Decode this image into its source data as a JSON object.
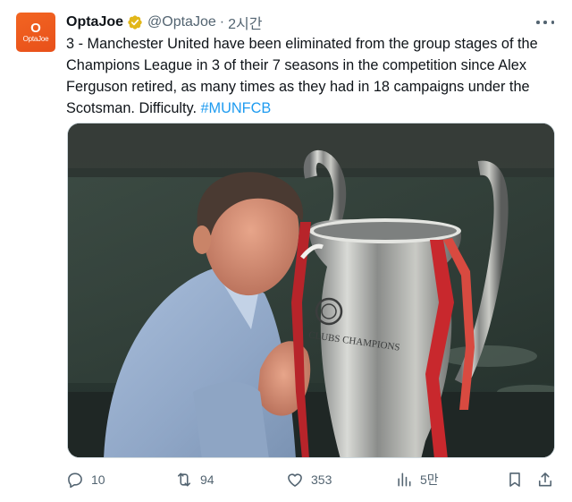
{
  "account": {
    "avatar_text_big": "O",
    "avatar_text_small": "OptaJoe",
    "display_name": "OptaJoe",
    "handle": "@OptaJoe",
    "separator": "·",
    "time": "2시간",
    "verified_color": "#e2b719"
  },
  "tweet": {
    "text_before": "3 - Manchester United have been eliminated from the group stages of the Champions League in 3 of their 7 seasons in the competition since Alex Ferguson retired, as many times as they had in 18 campaigns under the Scotsman. Difficulty. ",
    "hashtag": "#MUNFCB",
    "hashtag_color": "#1d9bf0"
  },
  "media": {
    "trophy_text": "CLUBS CHAMPIONS"
  },
  "actions": {
    "replies": "10",
    "retweets": "94",
    "likes": "353",
    "views": "5만"
  },
  "icons": [
    "more-icon",
    "verified-badge-icon",
    "reply-icon",
    "retweet-icon",
    "like-icon",
    "views-icon",
    "bookmark-icon",
    "share-icon"
  ]
}
